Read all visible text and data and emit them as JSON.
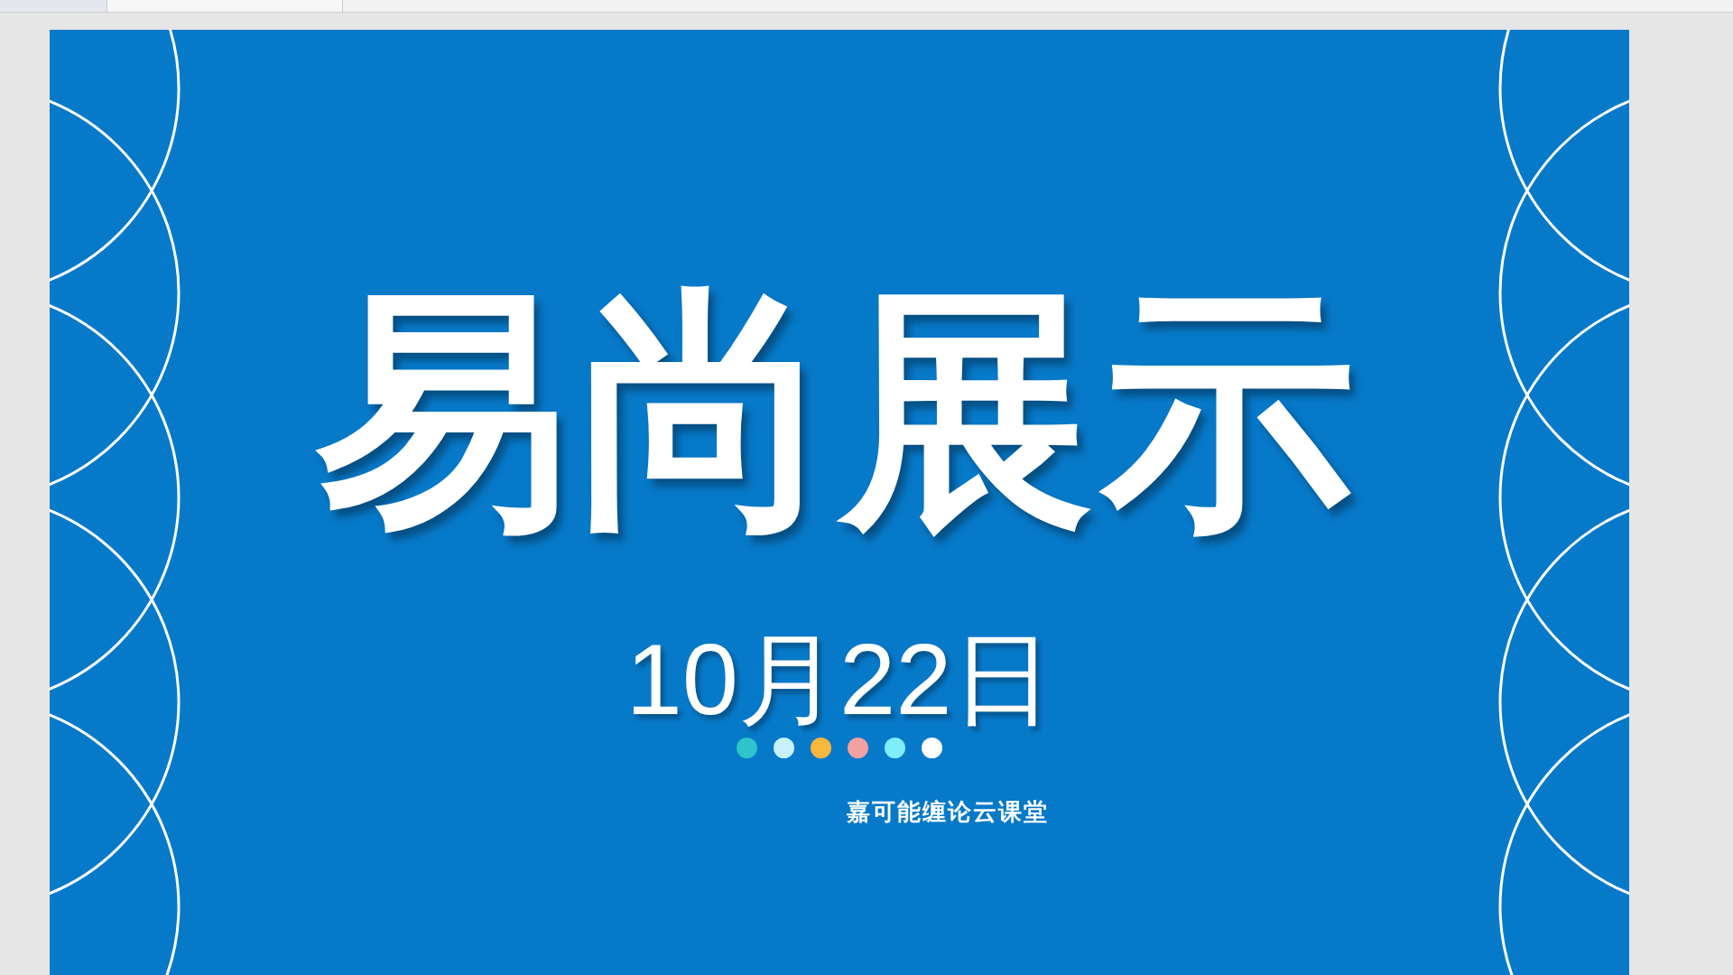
{
  "slide": {
    "title": "易尚展示",
    "date": "10月22日",
    "dots": [
      {
        "color": "#2ec4c9"
      },
      {
        "color": "#c9f1fb"
      },
      {
        "color": "#fbb63e"
      },
      {
        "color": "#f2a0a0"
      },
      {
        "color": "#7eeefa"
      },
      {
        "color": "#ffffff"
      }
    ],
    "footer": "嘉可能缠论云课堂"
  }
}
